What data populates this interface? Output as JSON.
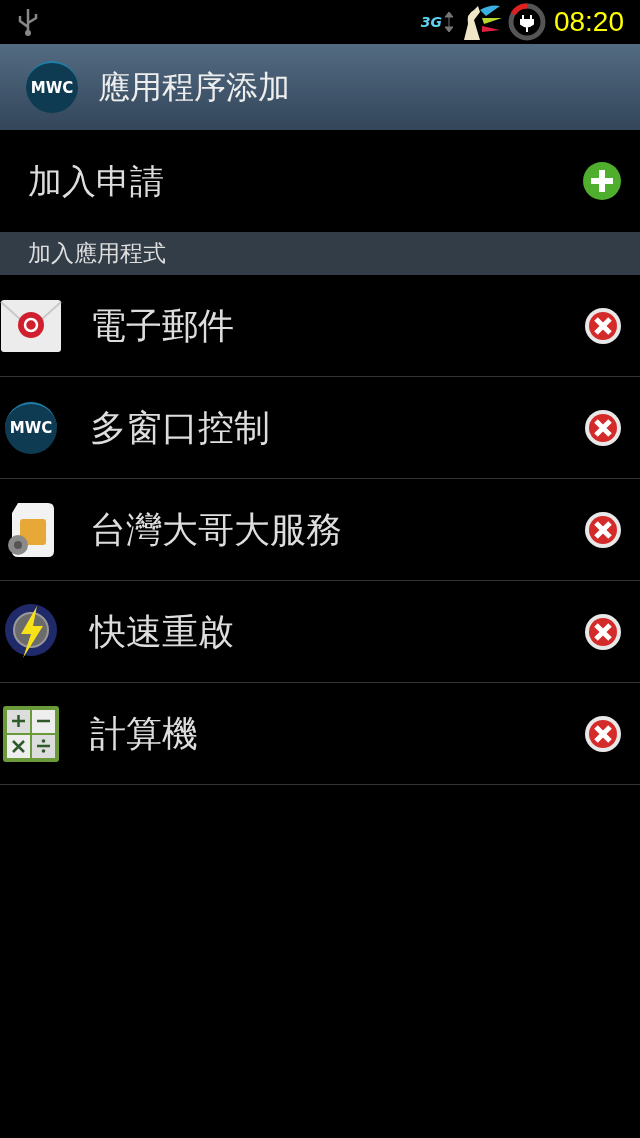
{
  "status_bar": {
    "network": "3G",
    "time": "08:20"
  },
  "header": {
    "logo_text": "MWC",
    "title": "應用程序添加"
  },
  "add_row": {
    "label": "加入申請"
  },
  "section": {
    "title": "加入應用程式"
  },
  "apps": [
    {
      "kind": "email",
      "name": "電子郵件"
    },
    {
      "kind": "mwc",
      "logo_text": "MWC",
      "name": "多窗口控制"
    },
    {
      "kind": "sim",
      "name": "台灣大哥大服務"
    },
    {
      "kind": "reboot",
      "name": "快速重啟"
    },
    {
      "kind": "calculator",
      "name": "計算機"
    }
  ]
}
